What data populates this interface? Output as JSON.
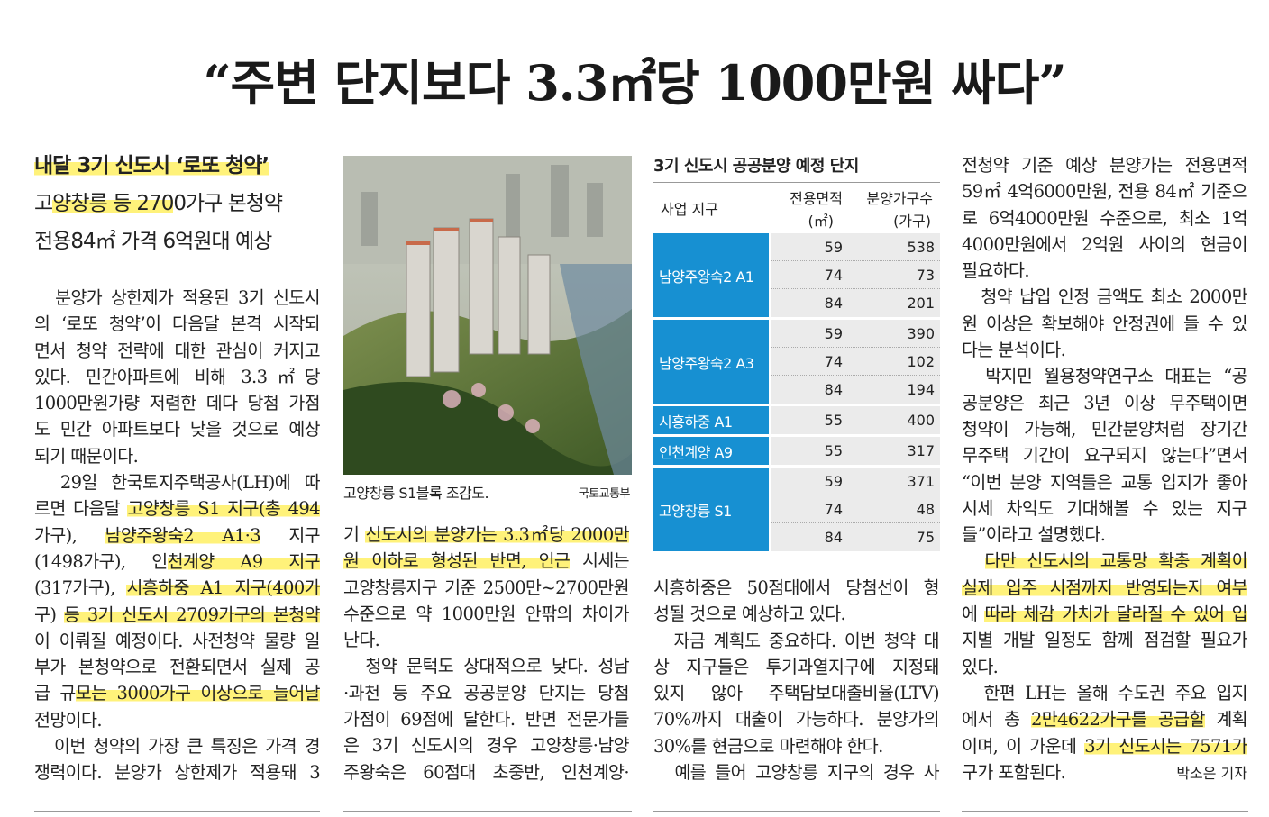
{
  "headline": "“주변 단지보다 3.3㎡당 1000만원 싸다”",
  "subheads": [
    {
      "s": [
        [
          "내달 3기 신도시 ‘로또 청약’",
          1
        ]
      ],
      "bold": true
    },
    {
      "s": [
        [
          "고",
          0
        ],
        [
          "양창릉 등 270",
          1
        ],
        [
          "0가구 본청약",
          0
        ]
      ]
    },
    {
      "s": [
        [
          "전용84㎡ 가격 6억원대 예상",
          0
        ]
      ]
    }
  ],
  "columns": [
    [
      {
        "s": [
          [
            "　분양가 상한제가 적용된 3기 신도시",
            0
          ]
        ]
      },
      {
        "s": [
          [
            "의 ‘로또 청약’이 다음달 본격 시작되",
            0
          ]
        ]
      },
      {
        "s": [
          [
            "면서 청약 전략에 대한 관심이 커지고",
            0
          ]
        ]
      },
      {
        "s": [
          [
            "있다. 민간아파트에 비해 3.3㎡당",
            0
          ]
        ]
      },
      {
        "s": [
          [
            "1000만원가량 저렴한 데다 당첨 가점",
            0
          ]
        ]
      },
      {
        "s": [
          [
            "도 민간 아파트보다 낮을 것으로 예상",
            0
          ]
        ]
      },
      {
        "s": [
          [
            "되기 때문이다.",
            0
          ]
        ],
        "last": true
      },
      {
        "s": [
          [
            "　29일 한국토지주택공사(LH)에 따",
            0
          ]
        ]
      },
      {
        "s": [
          [
            "르면 다음달 ",
            0
          ],
          [
            "고양창릉 S1 지구(총 494",
            1
          ]
        ]
      },
      {
        "s": [
          [
            "가구), ",
            0
          ],
          [
            "남양주왕숙2 A1·3",
            1
          ],
          [
            " 지구",
            0
          ]
        ]
      },
      {
        "s": [
          [
            "(1498가구), 인",
            0
          ],
          [
            "천계양 A9 지구",
            1
          ]
        ]
      },
      {
        "s": [
          [
            "(317가구), ",
            0
          ],
          [
            "시흥하중 A1 지구(400가",
            1
          ]
        ]
      },
      {
        "s": [
          [
            "구) ",
            0
          ],
          [
            "등 3기 신도시 2709가구의 본청약",
            1
          ]
        ]
      },
      {
        "s": [
          [
            "이 이뤄질 예정이다. 사전청약 물량 일",
            0
          ]
        ]
      },
      {
        "s": [
          [
            "부가 본청약으로 전환되면서 실제 공",
            0
          ]
        ]
      },
      {
        "s": [
          [
            "급 규",
            0
          ],
          [
            "모는 3000가구 이상으로 늘어날",
            1
          ]
        ]
      },
      {
        "s": [
          [
            "전망이다.",
            0
          ]
        ],
        "last": true
      },
      {
        "s": [
          [
            "　이번 청약의 가장 큰 특징은 가격 경",
            0
          ]
        ]
      },
      {
        "s": [
          [
            "쟁력이다. 분양가 상한제가 적용돼 3",
            0
          ]
        ]
      }
    ],
    [
      {
        "s": [
          [
            "기 ",
            0
          ],
          [
            "신도시의 분양가는 3.3㎡당 2000만",
            1
          ]
        ]
      },
      {
        "s": [
          [
            "원 이하로 형성된 반면, 인근",
            1
          ],
          [
            " 시세는",
            0
          ]
        ]
      },
      {
        "s": [
          [
            "고양창릉지구 기준 2500만~2700만원",
            0
          ]
        ]
      },
      {
        "s": [
          [
            "수준으로 약 1000만원 안팎의 차이가",
            0
          ]
        ]
      },
      {
        "s": [
          [
            "난다.",
            0
          ]
        ],
        "last": true
      },
      {
        "s": [
          [
            "　청약 문턱도 상대적으로 낮다. 성남",
            0
          ]
        ]
      },
      {
        "s": [
          [
            "·과천 등 주요 공공분양 단지는 당첨",
            0
          ]
        ]
      },
      {
        "s": [
          [
            "가점이 69점에 달한다. 반면 전문가들",
            0
          ]
        ]
      },
      {
        "s": [
          [
            "은 3기 신도시의 경우 고양창릉·남양",
            0
          ]
        ]
      },
      {
        "s": [
          [
            "주왕숙은 60점대 초중반, 인천계양·",
            0
          ]
        ]
      }
    ],
    [
      {
        "s": [
          [
            "시흥하중은 50점대에서 당첨선이 형",
            0
          ]
        ]
      },
      {
        "s": [
          [
            "성될 것으로 예상하고 있다.",
            0
          ]
        ],
        "last": true
      },
      {
        "s": [
          [
            "　자금 계획도 중요하다. 이번 청약 대",
            0
          ]
        ]
      },
      {
        "s": [
          [
            "상 지구들은 투기과열지구에 지정돼",
            0
          ]
        ]
      },
      {
        "s": [
          [
            "있지 않아 주택담보대출비율(LTV)",
            0
          ]
        ]
      },
      {
        "s": [
          [
            "70%까지 대출이 가능하다. 분양가의",
            0
          ]
        ]
      },
      {
        "s": [
          [
            "30%를 현금으로 마련해야 한다.",
            0
          ]
        ],
        "last": true
      },
      {
        "s": [
          [
            "　예를 들어 고양창릉 지구의 경우 사",
            0
          ]
        ]
      }
    ],
    [
      {
        "s": [
          [
            "전청약 기준 예상 분양가는 전용면적",
            0
          ]
        ]
      },
      {
        "s": [
          [
            "59㎡ 4억6000만원, 전용 84㎡ 기준으",
            0
          ]
        ]
      },
      {
        "s": [
          [
            "로 6억4000만원 수준으로, 최소 1억",
            0
          ]
        ]
      },
      {
        "s": [
          [
            "4000만원에서 2억원 사이의 현금이",
            0
          ]
        ]
      },
      {
        "s": [
          [
            "필요하다.",
            0
          ]
        ],
        "last": true
      },
      {
        "s": [
          [
            "　청약 납입 인정 금액도 최소 2000만",
            0
          ]
        ]
      },
      {
        "s": [
          [
            "원 이상은 확보해야 안정권에 들 수 있",
            0
          ]
        ]
      },
      {
        "s": [
          [
            "다는 분석이다.",
            0
          ]
        ],
        "last": true
      },
      {
        "s": [
          [
            "　박지민 월용청약연구소 대표는 “공",
            0
          ]
        ]
      },
      {
        "s": [
          [
            "공분양은 최근 3년 이상 무주택이면",
            0
          ]
        ]
      },
      {
        "s": [
          [
            "청약이 가능해, 민간분양처럼 장기간",
            0
          ]
        ]
      },
      {
        "s": [
          [
            "무주택 기간이 요구되지 않는다”면서",
            0
          ]
        ]
      },
      {
        "s": [
          [
            "“이번 분양 지역들은 교통 입지가 좋아",
            0
          ]
        ]
      },
      {
        "s": [
          [
            "시세 차익도 기대해볼 수 있는 지구",
            0
          ]
        ]
      },
      {
        "s": [
          [
            "들”이라고 설명했다.",
            0
          ]
        ],
        "last": true
      },
      {
        "s": [
          [
            "　",
            0
          ],
          [
            "다만 신도시의 교통망 확충 계획이",
            1
          ]
        ]
      },
      {
        "s": [
          [
            "실제 입주 시점까지 반영되는지 여부",
            1
          ]
        ]
      },
      {
        "s": [
          [
            "에 ",
            0
          ],
          [
            "따라 체감 가치가 달라질 수 있어 입",
            1
          ]
        ]
      },
      {
        "s": [
          [
            "지별 개발 일정도 함께 점검할 필요가",
            0
          ]
        ]
      },
      {
        "s": [
          [
            "있다.",
            0
          ]
        ],
        "last": true
      },
      {
        "s": [
          [
            "　한편 LH는 올해 수도권 주요 입지",
            0
          ]
        ]
      },
      {
        "s": [
          [
            "에서 총 ",
            0
          ],
          [
            "2만4622가구를 공급할",
            1
          ],
          [
            " 계획",
            0
          ]
        ]
      },
      {
        "s": [
          [
            "이며, 이 가운데 ",
            0
          ],
          [
            "3기 신도시는 7571가",
            1
          ]
        ]
      },
      {
        "s": [
          [
            "구가 포함된다.",
            0
          ]
        ],
        "last": true
      }
    ]
  ],
  "byline": "박소은 기자",
  "photo": {
    "caption": "고양창릉 S1블록 조감도.",
    "credit": "국토교통부"
  },
  "table": {
    "title": "3기 신도시 공공분양 예정 단지",
    "headers": {
      "district": "사업 지구",
      "area": "전용면적",
      "area_unit": "(㎡)",
      "units": "분양가구수",
      "units_unit": "(가구)"
    },
    "accent": "#1790d2",
    "groups": [
      {
        "district": "남양주왕숙2 A1",
        "rows": [
          [
            "59",
            "538"
          ],
          [
            "74",
            "73"
          ],
          [
            "84",
            "201"
          ]
        ]
      },
      {
        "district": "남양주왕숙2 A3",
        "rows": [
          [
            "59",
            "390"
          ],
          [
            "74",
            "102"
          ],
          [
            "84",
            "194"
          ]
        ]
      },
      {
        "district": "시흥하중 A1",
        "rows": [
          [
            "55",
            "400"
          ]
        ]
      },
      {
        "district": "인천계양 A9",
        "rows": [
          [
            "55",
            "317"
          ]
        ]
      },
      {
        "district": "고양창릉 S1",
        "rows": [
          [
            "59",
            "371"
          ],
          [
            "74",
            "48"
          ],
          [
            "84",
            "75"
          ]
        ]
      }
    ]
  }
}
